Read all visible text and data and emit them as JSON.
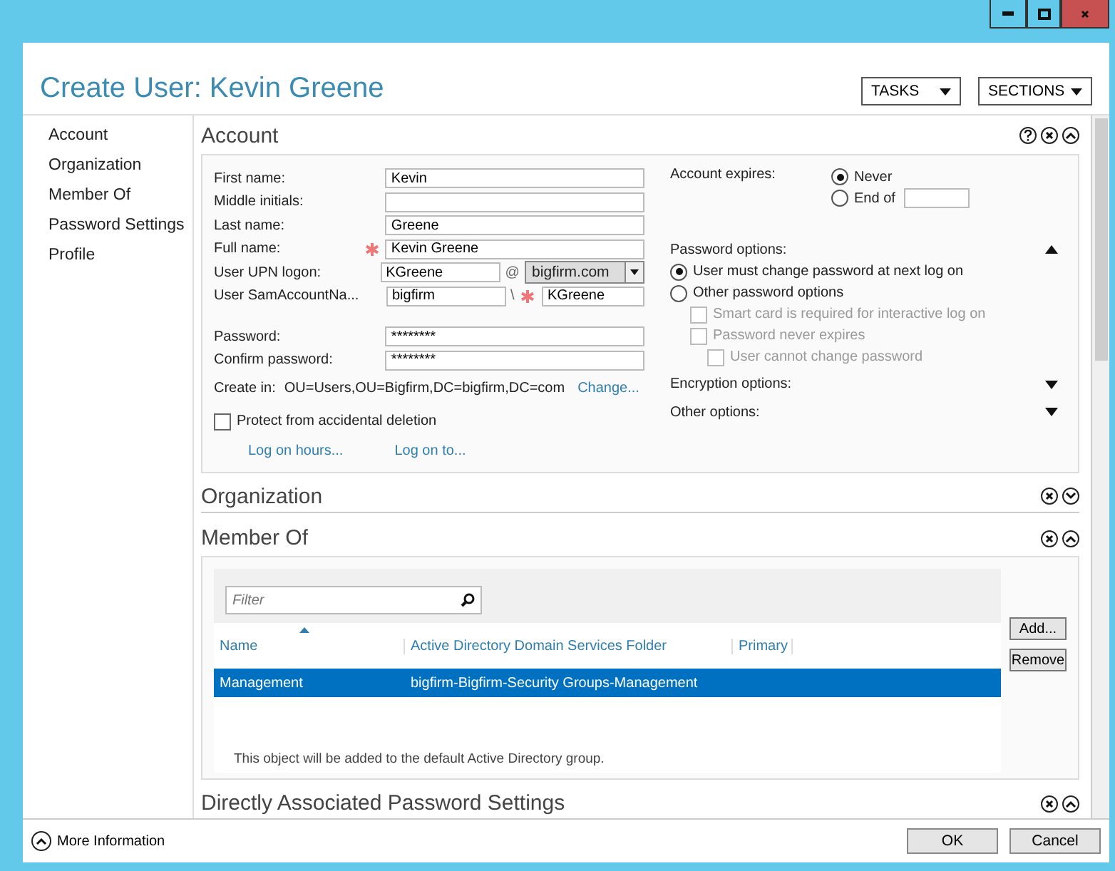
{
  "window": {
    "title": "Create User: Kevin Greene"
  },
  "header_buttons": [
    {
      "label": "TASKS"
    },
    {
      "label": "SECTIONS"
    }
  ],
  "nav": {
    "items": [
      {
        "label": "Account"
      },
      {
        "label": "Organization"
      },
      {
        "label": "Member Of"
      },
      {
        "label": "Password Settings"
      },
      {
        "label": "Profile"
      }
    ]
  },
  "account": {
    "title": "Account",
    "expanded": true,
    "fields": [
      {
        "kind": "text",
        "label": "First name:",
        "value": "Kevin",
        "required": false
      },
      {
        "kind": "text",
        "label": "Middle initials:",
        "required": false
      },
      {
        "kind": "text",
        "label": "Last name:",
        "value": "Greene",
        "required": false
      },
      {
        "kind": "text",
        "label": "Full name:",
        "value": "Kevin Greene",
        "required": true
      },
      {
        "kind": "upn",
        "label": "User UPN logon:",
        "value": "KGreene",
        "separator": "@",
        "domain": "bigfirm.com"
      },
      {
        "kind": "sam",
        "label": "User SamAccountNa...",
        "prefix": "bigfirm",
        "separator": "\\",
        "value": "KGreene",
        "required": true
      },
      {
        "kind": "password",
        "label": "Password:",
        "value": "********",
        "required": false
      },
      {
        "kind": "password",
        "label": "Confirm password:",
        "value": "********",
        "required": false
      }
    ],
    "create_in": {
      "label": "Create in:",
      "value": "OU=Users,OU=Bigfirm,DC=bigfirm,DC=com",
      "link": "Change..."
    },
    "protect": {
      "label": "Protect from accidental deletion",
      "checked": false
    },
    "links": [
      "Log on hours...",
      "Log on to..."
    ],
    "expires": {
      "label": "Account expires:",
      "options": [
        {
          "label": "Never",
          "selected": true
        },
        {
          "label": "End of",
          "selected": false
        }
      ]
    },
    "password_options": {
      "label": "Password options:",
      "expanded": true,
      "options": [
        {
          "label": "User must change password at next log on",
          "selected": true
        },
        {
          "label": "Other password options",
          "selected": false
        }
      ],
      "checkboxes": [
        {
          "label": "Smart card is required for interactive log on",
          "checked": false,
          "disabled": true
        },
        {
          "label": "Password never expires",
          "checked": false,
          "disabled": true,
          "children": [
            {
              "label": "User cannot change password",
              "checked": false,
              "disabled": true
            }
          ]
        }
      ]
    },
    "more_options": [
      {
        "label": "Encryption options:",
        "expanded": false
      },
      {
        "label": "Other options:",
        "expanded": false
      }
    ]
  },
  "organization": {
    "title": "Organization",
    "expanded": false
  },
  "member_of": {
    "title": "Member Of",
    "expanded": true,
    "filter": {
      "placeholder": "Filter"
    },
    "columns": [
      {
        "label": "Name",
        "sorted": true
      },
      {
        "label": "Active Directory Domain Services Folder",
        "sorted": false
      },
      {
        "label": "Primary",
        "sorted": false
      }
    ],
    "rows": [
      {
        "name": "Management",
        "folder": "bigfirm-Bigfirm-Security Groups-Management",
        "selected": true
      }
    ],
    "buttons": [
      "Add...",
      "Remove"
    ],
    "note": "This object will be added to the default Active Directory group."
  },
  "password_settings": {
    "title": "Directly Associated Password Settings",
    "expanded": true
  },
  "footer": {
    "more_info": "More Information",
    "buttons": [
      "OK",
      "Cancel"
    ]
  }
}
